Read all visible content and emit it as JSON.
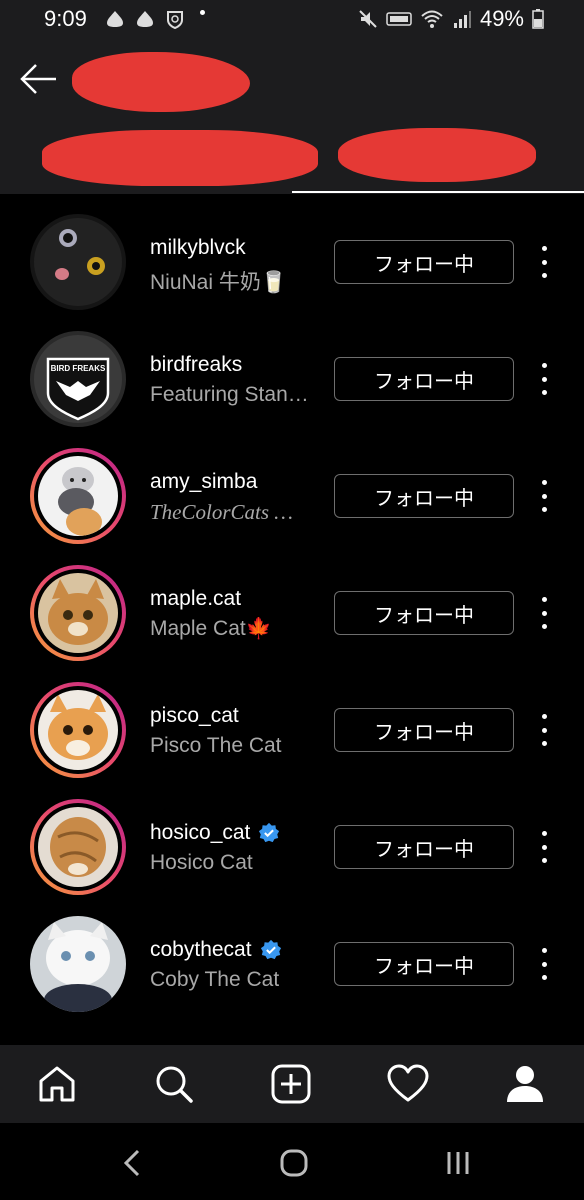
{
  "status_bar": {
    "time": "9:09",
    "battery": "49%"
  },
  "header": {
    "back_icon": "arrow-left-icon"
  },
  "following": [
    {
      "username": "milkyblvck",
      "display_name": "NiuNai 牛奶🥛",
      "button": "フォロー中",
      "verified": false,
      "story_ring": false
    },
    {
      "username": "birdfreaks",
      "display_name": "Featuring Stan…",
      "button": "フォロー中",
      "verified": false,
      "story_ring": false
    },
    {
      "username": "amy_simba",
      "display_name": "TheColorCats …",
      "button": "フォロー中",
      "verified": false,
      "story_ring": true
    },
    {
      "username": "maple.cat",
      "display_name": "Maple Cat🍁",
      "button": "フォロー中",
      "verified": false,
      "story_ring": true
    },
    {
      "username": "pisco_cat",
      "display_name": "Pisco The Cat",
      "button": "フォロー中",
      "verified": false,
      "story_ring": true
    },
    {
      "username": "hosico_cat",
      "display_name": "Hosico Cat",
      "button": "フォロー中",
      "verified": true,
      "story_ring": true
    },
    {
      "username": "cobythecat",
      "display_name": "Coby The Cat",
      "button": "フォロー中",
      "verified": true,
      "story_ring": false
    }
  ],
  "avatar_logo_text": "BIRD FREAKS",
  "colors": {
    "background": "#000000",
    "header": "#1c1c1e",
    "redaction": "#e53935",
    "verified": "#3897f0",
    "ring_start": "#f7a23a",
    "ring_end": "#b91e8c"
  },
  "bottom_nav": [
    "home-icon",
    "search-icon",
    "add-post-icon",
    "heart-icon",
    "profile-icon"
  ],
  "system_nav": [
    "back-icon",
    "home-circle-icon",
    "recents-icon"
  ]
}
